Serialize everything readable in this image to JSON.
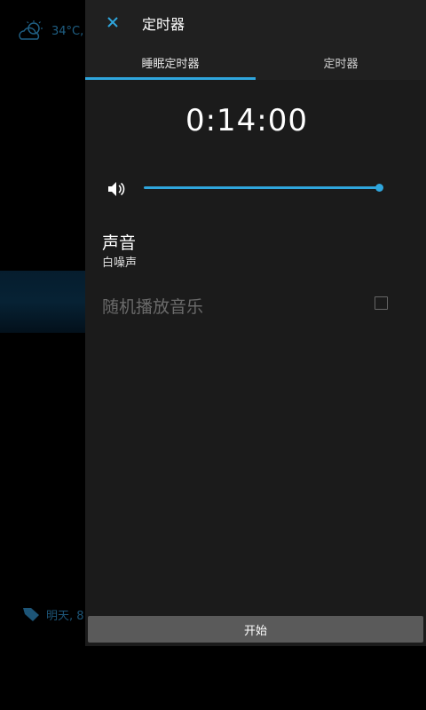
{
  "background": {
    "weather_text": "34°C,",
    "alarm_text": "明天, 8:"
  },
  "dialog": {
    "title": "定时器",
    "close_icon": "close-icon",
    "tabs": [
      {
        "label": "睡眠定时器",
        "selected": true
      },
      {
        "label": "定时器",
        "selected": false
      }
    ],
    "time": "0:14:00",
    "volume": {
      "icon": "volume-icon",
      "level": 1.0
    },
    "sound": {
      "title": "声音",
      "value": "白噪声"
    },
    "random_music": {
      "label": "随机播放音乐",
      "checked": false
    },
    "start_label": "开始"
  },
  "colors": {
    "accent": "#2fa6dd",
    "panel": "#1b1b1b",
    "header": "#202020",
    "button": "#5a5a5a"
  }
}
